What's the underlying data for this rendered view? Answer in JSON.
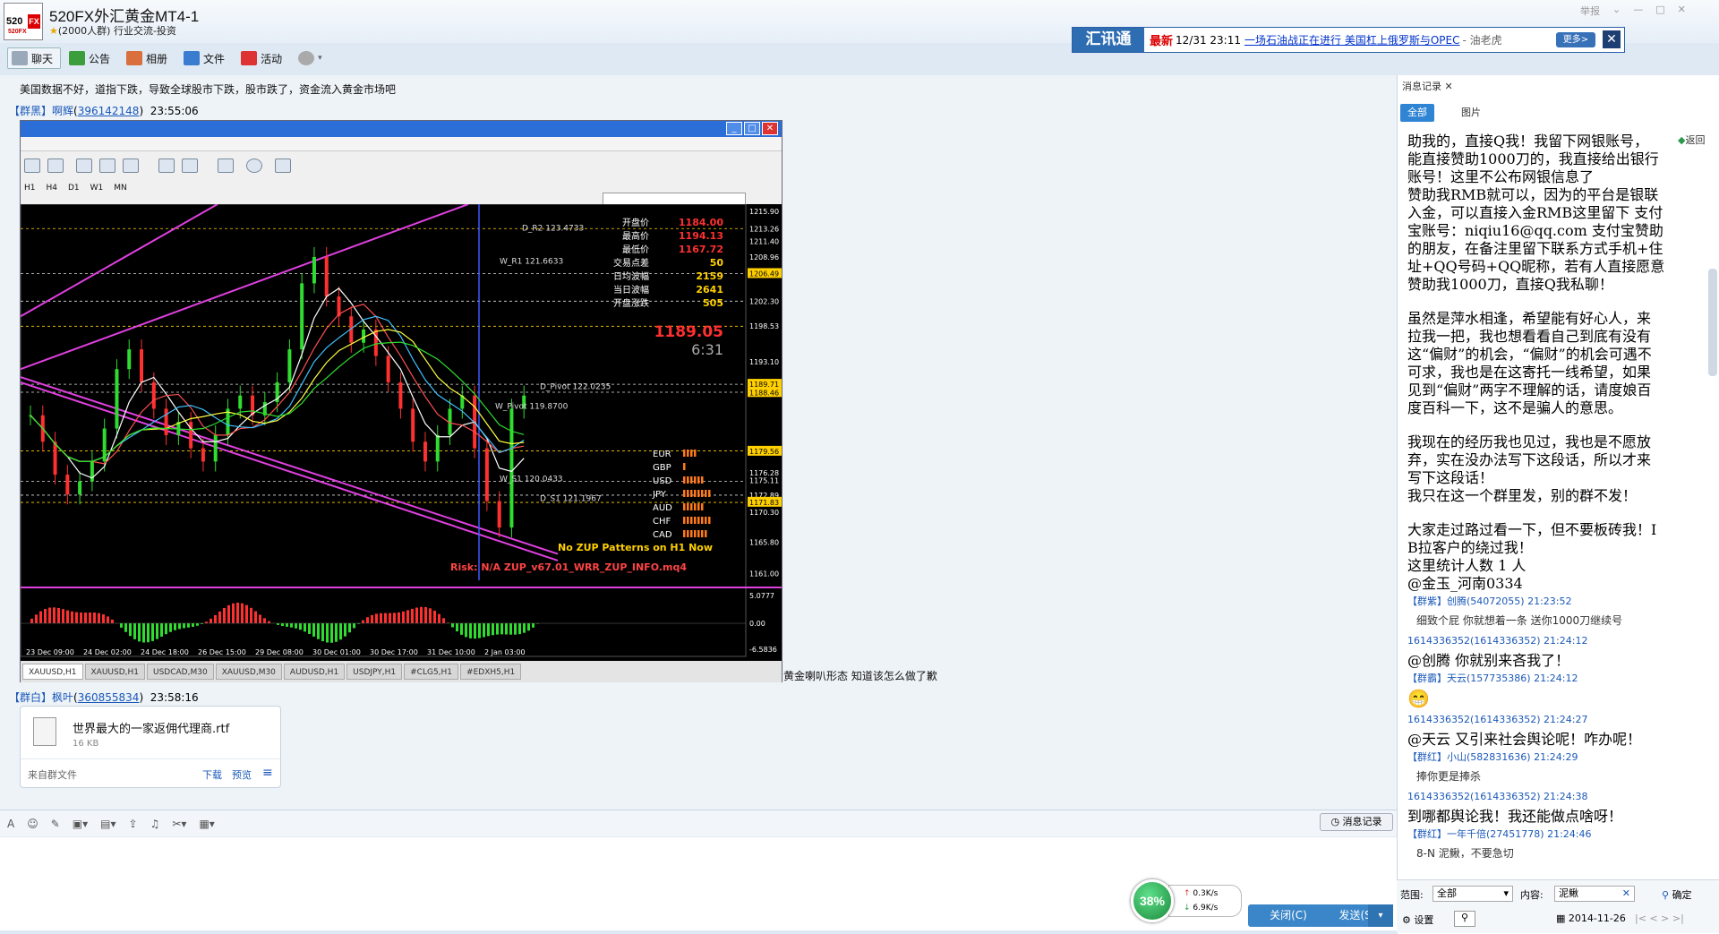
{
  "window": {
    "logo": {
      "text": "520",
      "badge": "FX",
      "sub": "520FX"
    },
    "group_name": "520FX外汇黄金MT4-1",
    "group_info": "(2000人群) 行业交流-投资",
    "controls": {
      "report": "举报",
      "min": "—",
      "max": "□",
      "close": "✕"
    }
  },
  "toolbar": {
    "items": [
      {
        "label": "聊天",
        "icon": "chat-icon"
      },
      {
        "label": "公告",
        "icon": "flag-icon"
      },
      {
        "label": "相册",
        "icon": "photo-icon"
      },
      {
        "label": "文件",
        "icon": "folder-icon"
      },
      {
        "label": "活动",
        "icon": "activity-flag-icon"
      }
    ],
    "settings_icon": "gear-icon"
  },
  "newsbar": {
    "logo": "汇讯通",
    "new_label": "最新",
    "date": "12/31 23:11",
    "headline": "一场石油战正在进行 美国杠上俄罗斯与OPEC",
    "author": "- 油老虎",
    "more": "更多>",
    "close": "✕"
  },
  "chat": {
    "message1_text": "美国数据不好，道指下跌，导致全球股市下跌，股市跌了，资金流入黄金市场吧",
    "message2_sender": {
      "tag": "【群黑】",
      "name": "啊辉",
      "id": "396142148",
      "time": "23:55:06"
    },
    "after_image_text": "黄金喇叭形态  知道该怎么做了歉",
    "message3_sender": {
      "tag": "【群白】",
      "name": "枫叶",
      "id": "360855834",
      "time": "23:58:16"
    },
    "file": {
      "name": "世界最大的一家返佣代理商.rtf",
      "size": "16 KB",
      "from": "来自群文件",
      "download": "下载",
      "preview": "预览"
    }
  },
  "mt4": {
    "timeframes": [
      "H1",
      "H4",
      "D1",
      "W1",
      "MN"
    ],
    "info_panel": [
      {
        "label": "开盘价",
        "value": "1184.00"
      },
      {
        "label": "最高价",
        "value": "1194.13"
      },
      {
        "label": "最低价",
        "value": "1167.72"
      },
      {
        "label": "交易点差",
        "value": "50"
      },
      {
        "label": "日均波幅",
        "value": "2159"
      },
      {
        "label": "当日波幅",
        "value": "2641"
      },
      {
        "label": "开盘涨跌",
        "value": "505"
      }
    ],
    "big_price": "1189.05",
    "countdown": "6:31",
    "price_axis": [
      "1215.90",
      "1213.26",
      "1211.40",
      "1208.96",
      "1206.49",
      "1202.30",
      "1198.53",
      "1193.10",
      "1189.71",
      "1188.46",
      "1179.56",
      "1176.28",
      "1175.11",
      "1172.89",
      "1171.83",
      "1170.30",
      "1165.80",
      "1161.00"
    ],
    "osc_axis": [
      "5.0777",
      "0.00",
      "-6.5836"
    ],
    "time_axis": [
      "23 Dec 09:00",
      "24 Dec 02:00",
      "24 Dec 18:00",
      "26 Dec 15:00",
      "29 Dec 08:00",
      "30 Dec 01:00",
      "30 Dec 17:00",
      "31 Dec 10:00",
      "2 Jan 03:00"
    ],
    "level_labels": [
      "D_R2 123.4733",
      "W_R1 121.6633",
      "W_Pivot 119.8700",
      "W_S1 120.0433",
      "D_S1 121.1967",
      "D_Pivot 122.0235",
      "Risk: N/A   ZUP_v67.01_WRR_ZUP_INFO.mq4"
    ],
    "zup_text": "No ZUP Patterns on H1 Now",
    "currencies": [
      "EUR",
      "GBP",
      "USD",
      "JPY",
      "AUD",
      "CHF",
      "CAD"
    ],
    "tabs": [
      "XAUUSD,H1",
      "XAUUSD,H1",
      "USDCAD,M30",
      "XAUUSD,M30",
      "AUDUSD,H1",
      "USDJPY,H1",
      "#CLG5,H1",
      "#EDXH5,H1"
    ]
  },
  "input": {
    "icons": [
      "font-icon",
      "emoji-icon",
      "pen-icon",
      "image-icon",
      "picture-icon",
      "upload-icon",
      "music-icon",
      "scissors-icon",
      "more-icon"
    ],
    "history_btn": "消息记录",
    "net_percent": "38%",
    "net_up": "0.3K/s",
    "net_down": "6.9K/s",
    "close_btn": "关闭(C)",
    "send_btn": "发送(S)"
  },
  "side": {
    "title": "消息记录",
    "filter_all": "全部",
    "filter_img": "图片",
    "back": "返回",
    "history": [
      {
        "type": "big",
        "text": "助我的，直接Q我！我留下网银账号，"
      },
      {
        "type": "big",
        "text": "能直接赞助1000刀的，我直接给出银行"
      },
      {
        "type": "big",
        "text": "账号！这里不公布网银信息了"
      },
      {
        "type": "big",
        "text": "赞助我RMB就可以，因为的平台是银联"
      },
      {
        "type": "big",
        "text": "入金，可以直接入金RMB这里留下 支付"
      },
      {
        "type": "big",
        "text": "宝账号：niqiu16@qq.com 支付宝赞助"
      },
      {
        "type": "big",
        "text": "的朋友，在备注里留下联系方式手机+住"
      },
      {
        "type": "big",
        "text": "址+QQ号码+QQ昵称，若有人直接愿意"
      },
      {
        "type": "big",
        "text": "赞助我1000刀，直接Q我私聊！"
      },
      {
        "type": "gap",
        "text": ""
      },
      {
        "type": "big",
        "text": "虽然是萍水相逢，希望能有好心人，来"
      },
      {
        "type": "big",
        "text": "拉我一把，我也想看看自己到底有没有"
      },
      {
        "type": "big",
        "text": "这“偏财”的机会，“偏财”的机会可遇不"
      },
      {
        "type": "big",
        "text": "可求，我也是在这寄托一线希望，如果"
      },
      {
        "type": "big",
        "text": "见到“偏财”两字不理解的话，请度娘百"
      },
      {
        "type": "big",
        "text": "度百科一下，这不是骗人的意思。"
      },
      {
        "type": "gap",
        "text": ""
      },
      {
        "type": "big",
        "text": "我现在的经历我也见过，我也是不愿放"
      },
      {
        "type": "big",
        "text": "弃，实在没办法写下这段话，所以才来"
      },
      {
        "type": "big",
        "text": "写下这段话！"
      },
      {
        "type": "big",
        "text": "我只在这一个群里发，别的群不发！"
      },
      {
        "type": "gap",
        "text": ""
      },
      {
        "type": "big",
        "text": "大家走过路过看一下，但不要板砖我！I"
      },
      {
        "type": "big",
        "text": "B拉客户的绕过我！"
      },
      {
        "type": "big",
        "text": "这里统计人数 1 人"
      },
      {
        "type": "big",
        "text": "@金玉_河南0334"
      },
      {
        "type": "meta",
        "text": "【群紫】创腾(54072055) 21:23:52"
      },
      {
        "type": "small",
        "text": "细致个屁 你就想着一条 送你1000刀继续号"
      },
      {
        "type": "meta",
        "text": "1614336352(1614336352) 21:24:12"
      },
      {
        "type": "big",
        "text": "@创腾 你就别来吝我了！"
      },
      {
        "type": "meta",
        "text": "【群霸】天云(157735386) 21:24:12"
      },
      {
        "type": "emoji",
        "text": "😁"
      },
      {
        "type": "meta",
        "text": "1614336352(1614336352) 21:24:27"
      },
      {
        "type": "big",
        "text": "@天云 又引来社会舆论呢！咋办呢！"
      },
      {
        "type": "meta",
        "text": "【群红】小山(582831636) 21:24:29"
      },
      {
        "type": "small",
        "text": "捧你更是捧杀"
      },
      {
        "type": "meta",
        "text": "1614336352(1614336352) 21:24:38"
      },
      {
        "type": "big",
        "text": "到哪都舆论我！我还能做点啥呀！"
      },
      {
        "type": "meta",
        "text": "【群红】一年千倍(27451778) 21:24:46"
      },
      {
        "type": "small",
        "text": "8-N  泥鳅，不要急切"
      }
    ],
    "range_label": "范围:",
    "range_value": "全部",
    "content_label": "内容:",
    "content_value": "泥鳅",
    "confirm": "确定",
    "settings": "设置",
    "date": "2014-11-26"
  }
}
